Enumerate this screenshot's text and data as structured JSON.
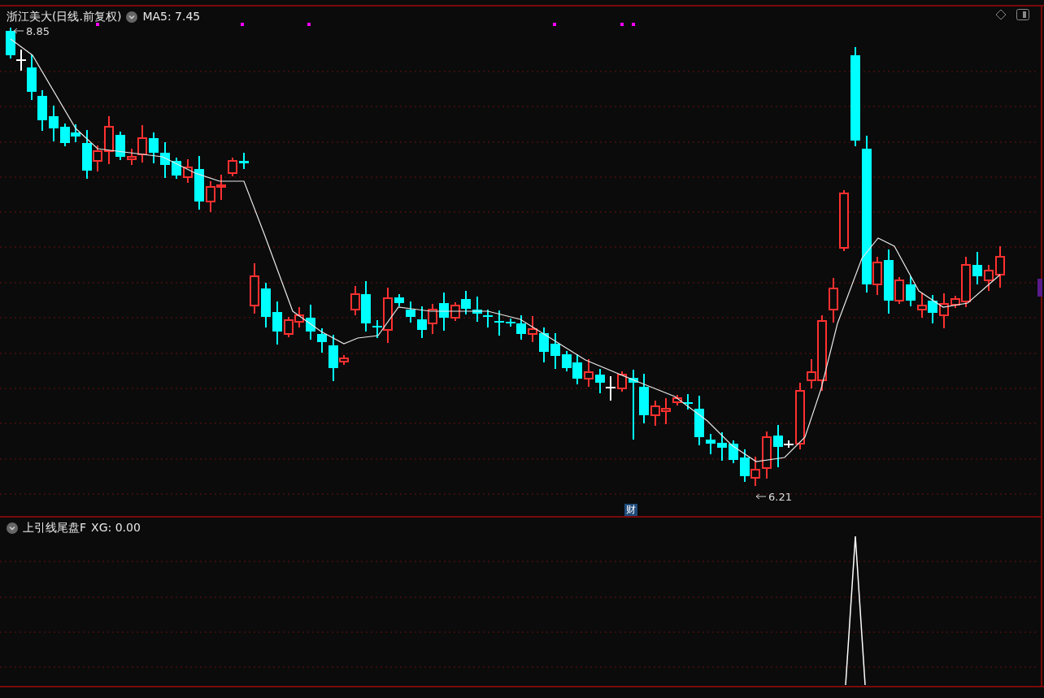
{
  "main_panel": {
    "title": "浙江美大(日线.前复权)",
    "ma_label": "MA5: 7.45",
    "high_label": "8.85",
    "low_label": "6.21",
    "event_marker": "财"
  },
  "indicator_panel": {
    "title": "上引线尾盘F",
    "value_label": "XG: 0.00"
  }
}
